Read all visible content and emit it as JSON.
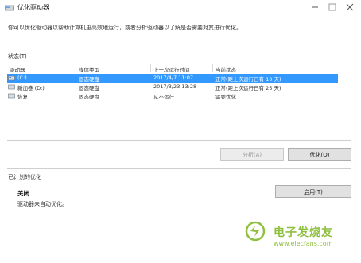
{
  "window": {
    "title": "优化驱动器"
  },
  "description": "你可以优化驱动器以帮助计算机更高效地运行，或者分析驱动器以了解是否需要对其进行优化。",
  "status": {
    "section_label": "状态(T)",
    "columns": [
      "驱动器",
      "媒体类型",
      "上一次运行时间",
      "当前状态"
    ],
    "rows": [
      {
        "drive": "(C:)",
        "media": "固态硬盘",
        "last_run": "2017/4/7 11:07",
        "status": "正常(距上次运行已有 10 天)",
        "selected": true
      },
      {
        "drive": "新加卷 (D:)",
        "media": "固态硬盘",
        "last_run": "2017/3/23 13:28",
        "status": "正常(距上次运行已有 25 天)",
        "selected": false
      },
      {
        "drive": "恢复",
        "media": "固态硬盘",
        "last_run": "从不运行",
        "status": "需要优化",
        "selected": false
      }
    ]
  },
  "buttons": {
    "analyze": "分析(A)",
    "optimize": "优化(O)",
    "enable": "启用(T)"
  },
  "scheduled": {
    "section_label": "已计划的优化",
    "state": "关闭",
    "note": "驱动器未自动优化。"
  },
  "watermark": {
    "text": "电子发烧友",
    "url": "www.elecfans.com"
  },
  "colors": {
    "selection": "#3399ff",
    "watermark": "#8fbf3f"
  }
}
